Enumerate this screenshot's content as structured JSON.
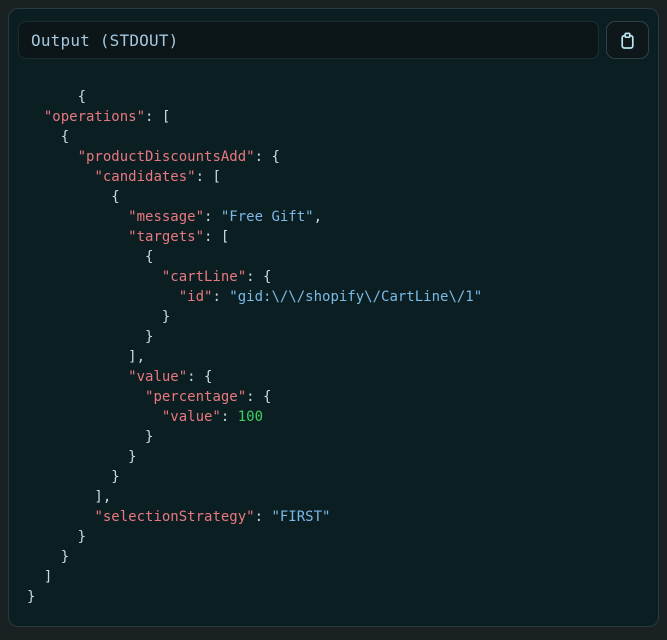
{
  "header": {
    "title": "Output (STDOUT)",
    "copy_button": {
      "icon": "clipboard-icon"
    }
  },
  "colors": {
    "outer_bg": "#1a2123",
    "panel_bg": "#0b1f23",
    "panel_border": "#2a3a3e",
    "titlebox_bg": "#0c1518",
    "titlebox_border": "#1d2c31",
    "button_bg": "#0e181b",
    "button_border": "#2f4147",
    "title_text": "#a4c8de",
    "icon": "#bce4f0",
    "punctuation": "#cfd9dd",
    "key": "#e8787f",
    "string": "#7bb9e6",
    "number": "#3fcf5f"
  },
  "output": {
    "language": "json",
    "lines": [
      [
        {
          "t": "p",
          "v": "      {"
        }
      ],
      [
        {
          "t": "p",
          "v": "  "
        },
        {
          "t": "k",
          "v": "\"operations\""
        },
        {
          "t": "p",
          "v": ": ["
        }
      ],
      [
        {
          "t": "p",
          "v": "    {"
        }
      ],
      [
        {
          "t": "p",
          "v": "      "
        },
        {
          "t": "k",
          "v": "\"productDiscountsAdd\""
        },
        {
          "t": "p",
          "v": ": {"
        }
      ],
      [
        {
          "t": "p",
          "v": "        "
        },
        {
          "t": "k",
          "v": "\"candidates\""
        },
        {
          "t": "p",
          "v": ": ["
        }
      ],
      [
        {
          "t": "p",
          "v": "          {"
        }
      ],
      [
        {
          "t": "p",
          "v": "            "
        },
        {
          "t": "k",
          "v": "\"message\""
        },
        {
          "t": "p",
          "v": ": "
        },
        {
          "t": "s",
          "v": "\"Free Gift\""
        },
        {
          "t": "p",
          "v": ","
        }
      ],
      [
        {
          "t": "p",
          "v": "            "
        },
        {
          "t": "k",
          "v": "\"targets\""
        },
        {
          "t": "p",
          "v": ": ["
        }
      ],
      [
        {
          "t": "p",
          "v": "              {"
        }
      ],
      [
        {
          "t": "p",
          "v": "                "
        },
        {
          "t": "k",
          "v": "\"cartLine\""
        },
        {
          "t": "p",
          "v": ": {"
        }
      ],
      [
        {
          "t": "p",
          "v": "                  "
        },
        {
          "t": "k",
          "v": "\"id\""
        },
        {
          "t": "p",
          "v": ": "
        },
        {
          "t": "s",
          "v": "\"gid:\\/\\/shopify\\/CartLine\\/1\""
        }
      ],
      [
        {
          "t": "p",
          "v": "                }"
        }
      ],
      [
        {
          "t": "p",
          "v": "              }"
        }
      ],
      [
        {
          "t": "p",
          "v": "            ],"
        }
      ],
      [
        {
          "t": "p",
          "v": "            "
        },
        {
          "t": "k",
          "v": "\"value\""
        },
        {
          "t": "p",
          "v": ": {"
        }
      ],
      [
        {
          "t": "p",
          "v": "              "
        },
        {
          "t": "k",
          "v": "\"percentage\""
        },
        {
          "t": "p",
          "v": ": {"
        }
      ],
      [
        {
          "t": "p",
          "v": "                "
        },
        {
          "t": "k",
          "v": "\"value\""
        },
        {
          "t": "p",
          "v": ": "
        },
        {
          "t": "n",
          "v": "100"
        }
      ],
      [
        {
          "t": "p",
          "v": "              }"
        }
      ],
      [
        {
          "t": "p",
          "v": "            }"
        }
      ],
      [
        {
          "t": "p",
          "v": "          }"
        }
      ],
      [
        {
          "t": "p",
          "v": "        ],"
        }
      ],
      [
        {
          "t": "p",
          "v": "        "
        },
        {
          "t": "k",
          "v": "\"selectionStrategy\""
        },
        {
          "t": "p",
          "v": ": "
        },
        {
          "t": "s",
          "v": "\"FIRST\""
        }
      ],
      [
        {
          "t": "p",
          "v": "      }"
        }
      ],
      [
        {
          "t": "p",
          "v": "    }"
        }
      ],
      [
        {
          "t": "p",
          "v": "  ]"
        }
      ],
      [
        {
          "t": "p",
          "v": "}"
        }
      ]
    ]
  }
}
